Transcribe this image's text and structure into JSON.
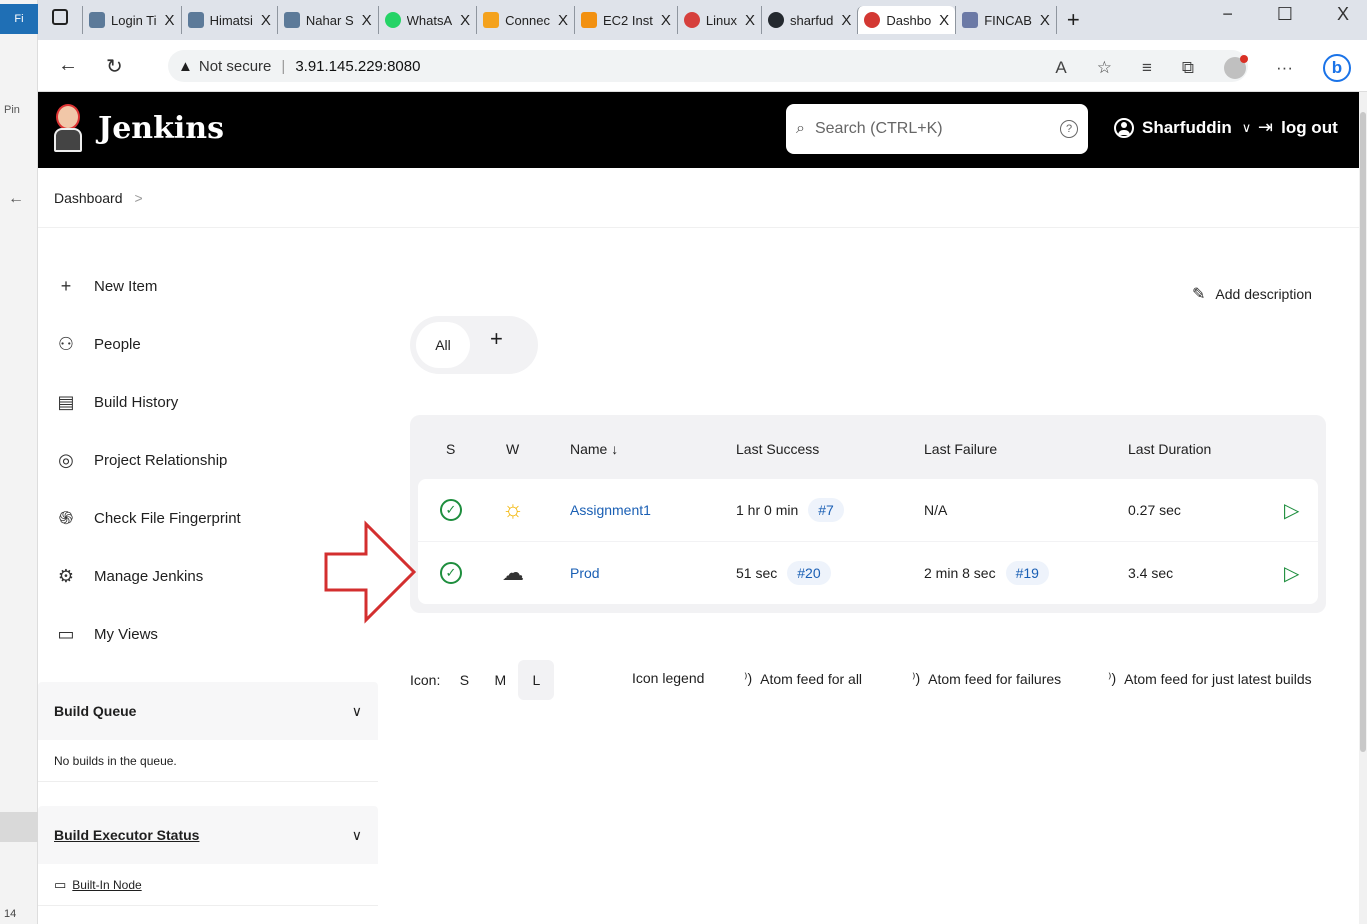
{
  "browser": {
    "tabs": [
      {
        "title": "Login Ti",
        "fav": "#5c7a99"
      },
      {
        "title": "Himatsi",
        "fav": "#5c7a99"
      },
      {
        "title": "Nahar S",
        "fav": "#5c7a99"
      },
      {
        "title": "WhatsA",
        "fav": "#25d366"
      },
      {
        "title": "Connec",
        "fav": "#f4a21d"
      },
      {
        "title": "EC2 Inst",
        "fav": "#f29111"
      },
      {
        "title": "Linux",
        "fav": "#d6403d"
      },
      {
        "title": "sharfud",
        "fav": "#24292f"
      },
      {
        "title": "Dashbo",
        "fav": "#d33833"
      },
      {
        "title": "FINCAB",
        "fav": "#6c7aa6"
      }
    ],
    "active_tab_index": 8,
    "tab_close": "X",
    "new_tab": "+",
    "minimize": "−",
    "maximize": "☐",
    "close": "X",
    "security_label": "Not secure",
    "url": "3.91.145.229:8080",
    "left_strip": {
      "fi": "Fi",
      "pin": "Pin",
      "num": "14"
    }
  },
  "header": {
    "brand": "Jenkins",
    "search_placeholder": "Search (CTRL+K)",
    "help": "?",
    "user": "Sharfuddin",
    "logout": "log out"
  },
  "breadcrumb": {
    "item": "Dashboard",
    "sep": ">"
  },
  "sidebar": {
    "tasks": [
      {
        "label": "New Item",
        "icon": "plus-icon"
      },
      {
        "label": "People",
        "icon": "people-icon"
      },
      {
        "label": "Build History",
        "icon": "history-icon"
      },
      {
        "label": "Project Relationship",
        "icon": "relationship-icon"
      },
      {
        "label": "Check File Fingerprint",
        "icon": "fingerprint-icon"
      },
      {
        "label": "Manage Jenkins",
        "icon": "gear-icon"
      },
      {
        "label": "My Views",
        "icon": "window-icon"
      }
    ],
    "build_queue": {
      "title": "Build Queue",
      "empty": "No builds in the queue."
    },
    "executor": {
      "title": "Build Executor Status",
      "node": "Built-In Node"
    }
  },
  "main": {
    "add_description": "Add description",
    "views": {
      "all": "All",
      "add": "+"
    },
    "table": {
      "headers": [
        "S",
        "W",
        "Name ↓",
        "Last Success",
        "Last Failure",
        "Last Duration"
      ],
      "rows": [
        {
          "status": "success",
          "weather": "sunny",
          "name": "Assignment1",
          "last_success": "1 hr 0 min",
          "success_build": "#7",
          "last_failure": "N/A",
          "failure_build": "",
          "duration": "0.27 sec"
        },
        {
          "status": "success",
          "weather": "stormy",
          "name": "Prod",
          "last_success": "51 sec",
          "success_build": "#20",
          "last_failure": "2 min 8 sec",
          "failure_build": "#19",
          "duration": "3.4 sec"
        }
      ]
    },
    "footer": {
      "icon_label": "Icon:",
      "sizes": [
        "S",
        "M",
        "L"
      ],
      "selected_size": "L",
      "icon_legend": "Icon legend",
      "atom_all": "Atom feed for all",
      "atom_failures": "Atom feed for failures",
      "atom_latest": "Atom feed for just latest builds"
    }
  },
  "colors": {
    "success": "#1e8e3e",
    "link": "#1a5fb4",
    "header_bg": "#000000",
    "annotation_arrow": "#d32f2f"
  }
}
